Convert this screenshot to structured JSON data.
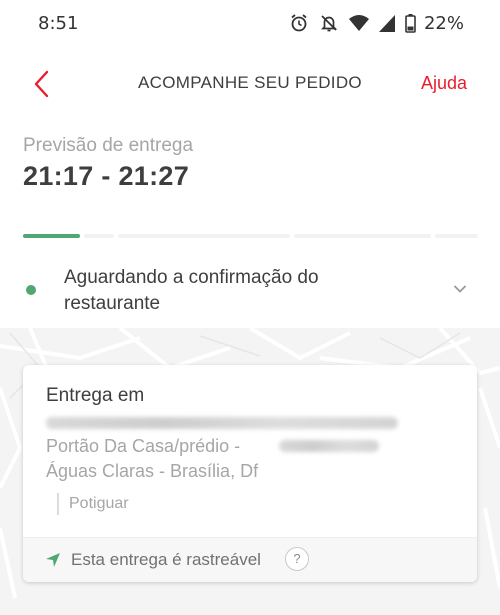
{
  "status_bar": {
    "time": "8:51",
    "battery": "22%",
    "icons": [
      "alarm-icon",
      "notifications-off-icon",
      "wifi-icon",
      "cell-signal-icon",
      "battery-icon"
    ]
  },
  "header": {
    "back_icon": "chevron-left-icon",
    "title": "ACOMPANHE SEU PEDIDO",
    "help_label": "Ajuda"
  },
  "delivery": {
    "eta_label": "Previsão de entrega",
    "eta_value": "21:17 - 21:27"
  },
  "progress": {
    "total_steps": 5,
    "completed_steps": 1
  },
  "order_status": {
    "text": "Aguardando a confirmação do restaurante",
    "expand_icon": "chevron-down-icon"
  },
  "address_card": {
    "title": "Entrega em",
    "line_1": "Portão Da Casa/prédio -",
    "line_2": "Águas Claras - Brasília, Df",
    "reference": "Potiguar",
    "tracking_text": "Esta entrega é rastreável",
    "tracking_help": "?"
  },
  "colors": {
    "accent": "#ea1d2c",
    "status_green": "#50a773",
    "text_dark": "#3f3e3e",
    "text_muted": "#a6a6a6"
  }
}
